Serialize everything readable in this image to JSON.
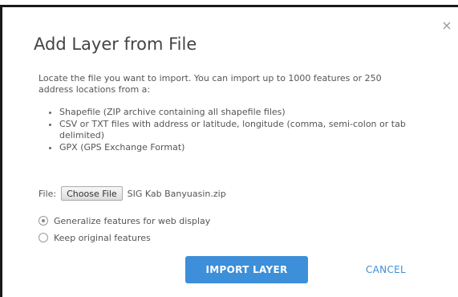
{
  "dialog": {
    "title": "Add Layer from File",
    "close_icon": "×",
    "intro": "Locate the file you want to import. You can import up to 1000 features or 250 address locations from a:",
    "formats": [
      "Shapefile (ZIP archive containing all shapefile files)",
      "CSV or TXT files with address or latitude, longitude (comma, semi-colon or tab delimited)",
      "GPX (GPS Exchange Format)"
    ],
    "file": {
      "label": "File:",
      "choose_label": "Choose File",
      "selected_name": "SIG Kab Banyuasin.zip"
    },
    "options": [
      {
        "label": "Generalize features for web display",
        "checked": true
      },
      {
        "label": "Keep original features",
        "checked": false
      }
    ],
    "import_label": "IMPORT LAYER",
    "cancel_label": "CANCEL"
  },
  "colors": {
    "accent": "#3d8fd9",
    "text": "#555555",
    "title": "#444444"
  },
  "icons": {
    "close": "close-icon",
    "radio_checked": "radio-checked-icon",
    "radio_unchecked": "radio-unchecked-icon"
  }
}
